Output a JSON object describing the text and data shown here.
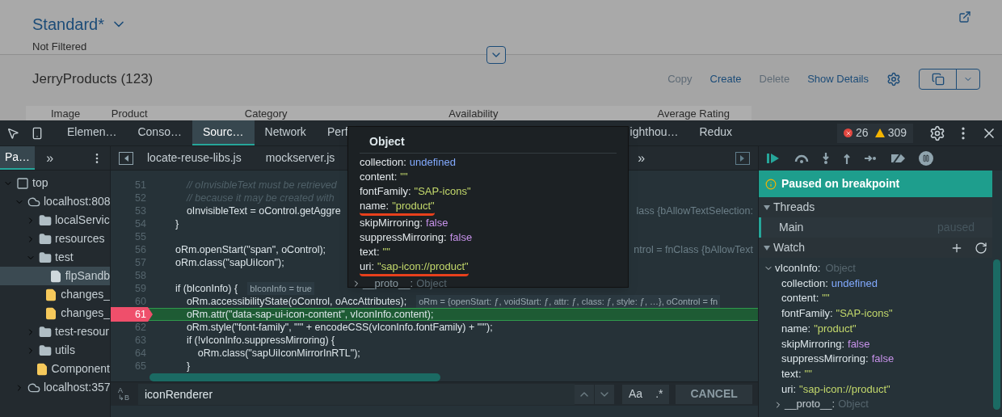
{
  "page": {
    "variant_title": "Standard*",
    "filter_status": "Not Filtered",
    "table_title": "JerryProducts (123)",
    "actions": [
      {
        "label": "Copy",
        "disabled": true
      },
      {
        "label": "Create",
        "disabled": false
      },
      {
        "label": "Delete",
        "disabled": true
      },
      {
        "label": "Show Details",
        "disabled": false
      }
    ],
    "columns": [
      "Image",
      "Product",
      "Category",
      "Availability",
      "Average Rating"
    ]
  },
  "devtools": {
    "tabs": [
      {
        "label": "Elemen…",
        "selected": false
      },
      {
        "label": "Conso…",
        "selected": false
      },
      {
        "label": "Sourc…",
        "selected": true
      },
      {
        "label": "Network",
        "selected": false
      },
      {
        "label": "Perf",
        "selected": false
      },
      {
        "label": "ighthou…",
        "selected": false
      },
      {
        "label": "Redux",
        "selected": false
      }
    ],
    "errors": "26",
    "warnings": "309"
  },
  "navigator": {
    "tabs": [
      {
        "label": "Pa…",
        "selected": true
      }
    ],
    "more": "»",
    "tree": [
      {
        "label": "top",
        "kind": "frame",
        "expanded": true,
        "selected": false,
        "children": [
          {
            "label": "localhost:808",
            "kind": "origin",
            "expanded": true,
            "selected": false,
            "children": [
              {
                "label": "localServic",
                "kind": "folder",
                "expanded": false,
                "selected": false
              },
              {
                "label": "resources",
                "kind": "folder",
                "expanded": false,
                "selected": false
              },
              {
                "label": "test",
                "kind": "folder",
                "expanded": true,
                "selected": false,
                "children": [
                  {
                    "label": "flpSandb",
                    "kind": "html",
                    "selected": true
                  },
                  {
                    "label": "changes_",
                    "kind": "file",
                    "selected": false
                  },
                  {
                    "label": "changes_",
                    "kind": "file",
                    "selected": false
                  }
                ]
              },
              {
                "label": "test-resour",
                "kind": "folder",
                "expanded": false,
                "selected": false
              },
              {
                "label": "utils",
                "kind": "folder",
                "expanded": false,
                "selected": false
              },
              {
                "label": "Component",
                "kind": "file",
                "selected": false
              }
            ]
          },
          {
            "label": "localhost:357",
            "kind": "origin",
            "expanded": false,
            "selected": false
          }
        ]
      }
    ]
  },
  "editor": {
    "files": [
      "locate-reuse-libs.js",
      "mockserver.js"
    ],
    "more": "»",
    "lines": [
      {
        "number": "51",
        "kind": "comment",
        "text": "    // oInvisibleText must be retrieved",
        "current": false
      },
      {
        "number": "52",
        "kind": "comment",
        "text": "    // because it may be created with",
        "current": false
      },
      {
        "number": "53",
        "kind": "code",
        "text": "    oInvisibleText = oControl.getAggre",
        "tail": "lass {bAllowTextSelection:",
        "current": false
      },
      {
        "number": "54",
        "kind": "code",
        "text": "}",
        "current": false
      },
      {
        "number": "55",
        "current": false
      },
      {
        "number": "56",
        "kind": "code",
        "text": "oRm.openStart(\"span\", oControl);",
        "tail": "ntrol = fnClass {bAllowText",
        "current": false
      },
      {
        "number": "57",
        "kind": "code",
        "text": "oRm.class(\"sapUiIcon\");",
        "current": false
      },
      {
        "number": "58",
        "current": false
      },
      {
        "number": "59",
        "kind": "code",
        "text": "if (bIconInfo) {",
        "inline": "bIconInfo = true",
        "current": false
      },
      {
        "number": "60",
        "kind": "code",
        "text": "    oRm.accessibilityState(oControl, oAccAttributes);",
        "inline": "oRm = {openStart: ƒ, voidStart: ƒ, attr: ƒ, class: ƒ, style: ƒ, …}, oControl = fn",
        "current": false
      },
      {
        "number": "61",
        "kind": "code",
        "text": "    oRm.attr(\"data-sap-ui-icon-content\", vIconInfo.content);",
        "current": true
      },
      {
        "number": "62",
        "kind": "code",
        "text": "    oRm.style(\"font-family\", \"'\" + encodeCSS(vIconInfo.fontFamily) + \"'\");",
        "current": false
      },
      {
        "number": "63",
        "kind": "code",
        "text": "    if (!vIconInfo.suppressMirroring) {",
        "current": false
      },
      {
        "number": "64",
        "kind": "code",
        "text": "        oRm.class(\"sapUiIconMirrorInRTL\");",
        "current": false
      },
      {
        "number": "65",
        "kind": "code",
        "text": "    }",
        "current": false
      }
    ],
    "search": {
      "replace_toggle": [
        "A",
        "↳B"
      ],
      "value": "iconRenderer",
      "case": "Aa",
      "regex": ".*",
      "cancel": "CANCEL"
    }
  },
  "popup": {
    "title": "Object",
    "properties": [
      {
        "key": "collection:",
        "value": "undefined",
        "kind": "undefined",
        "underlined": false
      },
      {
        "key": "content:",
        "value": "\"\"",
        "kind": "string",
        "underlined": false
      },
      {
        "key": "fontFamily:",
        "value": "\"SAP-icons\"",
        "kind": "string",
        "underlined": false
      },
      {
        "key": "name:",
        "value": "\"product\"",
        "kind": "string",
        "underlined": true
      },
      {
        "key": "skipMirroring:",
        "value": "false",
        "kind": "boolean",
        "underlined": false
      },
      {
        "key": "suppressMirroring:",
        "value": "false",
        "kind": "boolean",
        "underlined": false
      },
      {
        "key": "text:",
        "value": "\"\"",
        "kind": "string",
        "underlined": false
      },
      {
        "key": "uri:",
        "value": "\"sap-icon://product\"",
        "kind": "string",
        "underlined": true
      }
    ],
    "proto": {
      "key": "__proto__:",
      "value": "Object"
    }
  },
  "debugger": {
    "status": "Paused on breakpoint",
    "threads": {
      "title": "Threads",
      "expanded": true,
      "items": [
        {
          "name": "Main",
          "status": "paused",
          "selected": true
        }
      ]
    },
    "watch": {
      "title": "Watch",
      "expanded": true,
      "expression": {
        "name": "vIconInfo:",
        "value": "Object",
        "expanded": true,
        "properties": [
          {
            "key": "collection:",
            "value": "undefined",
            "kind": "undefined"
          },
          {
            "key": "content:",
            "value": "\"\"",
            "kind": "string"
          },
          {
            "key": "fontFamily:",
            "value": "\"SAP-icons\"",
            "kind": "string"
          },
          {
            "key": "name:",
            "value": "\"product\"",
            "kind": "string"
          },
          {
            "key": "skipMirroring:",
            "value": "false",
            "kind": "boolean"
          },
          {
            "key": "suppressMirroring:",
            "value": "false",
            "kind": "boolean"
          },
          {
            "key": "text:",
            "value": "\"\"",
            "kind": "string"
          },
          {
            "key": "uri:",
            "value": "\"sap-icon://product\"",
            "kind": "string"
          }
        ],
        "proto": {
          "key": "__proto__:",
          "value": "Object"
        }
      }
    }
  }
}
